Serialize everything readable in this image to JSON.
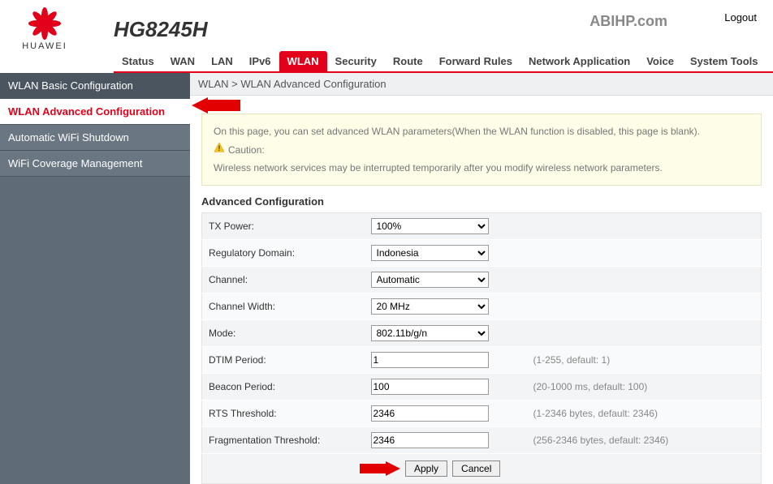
{
  "header": {
    "brand": "HUAWEI",
    "model": "HG8245H",
    "watermark": "ABIHP.com",
    "logout": "Logout"
  },
  "topnav": {
    "items": [
      "Status",
      "WAN",
      "LAN",
      "IPv6",
      "WLAN",
      "Security",
      "Route",
      "Forward Rules",
      "Network Application",
      "Voice",
      "System Tools"
    ],
    "active": "WLAN"
  },
  "sidebar": {
    "items": [
      {
        "label": "WLAN Basic Configuration",
        "active": false
      },
      {
        "label": "WLAN Advanced Configuration",
        "active": true
      },
      {
        "label": "Automatic WiFi Shutdown",
        "active": false
      },
      {
        "label": "WiFi Coverage Management",
        "active": false
      }
    ]
  },
  "breadcrumb": "WLAN > WLAN Advanced Configuration",
  "infobox": {
    "line1": "On this page, you can set advanced WLAN parameters(When the WLAN function is disabled, this page is blank).",
    "caution": "Caution:",
    "line2": "Wireless network services may be interrupted temporarily after you modify wireless network parameters."
  },
  "section_title": "Advanced Configuration",
  "form": {
    "rows": [
      {
        "label": "TX Power:",
        "type": "select",
        "value": "100%",
        "hint": ""
      },
      {
        "label": "Regulatory Domain:",
        "type": "select",
        "value": "Indonesia",
        "hint": ""
      },
      {
        "label": "Channel:",
        "type": "select",
        "value": "Automatic",
        "hint": ""
      },
      {
        "label": "Channel Width:",
        "type": "select",
        "value": "20 MHz",
        "hint": ""
      },
      {
        "label": "Mode:",
        "type": "select",
        "value": "802.11b/g/n",
        "hint": ""
      },
      {
        "label": "DTIM Period:",
        "type": "text",
        "value": "1",
        "hint": "(1-255, default: 1)"
      },
      {
        "label": "Beacon Period:",
        "type": "text",
        "value": "100",
        "hint": "(20-1000 ms, default: 100)"
      },
      {
        "label": "RTS Threshold:",
        "type": "text",
        "value": "2346",
        "hint": "(1-2346 bytes, default: 2346)"
      },
      {
        "label": "Fragmentation Threshold:",
        "type": "text",
        "value": "2346",
        "hint": "(256-2346 bytes, default: 2346)"
      }
    ]
  },
  "buttons": {
    "apply": "Apply",
    "cancel": "Cancel"
  }
}
